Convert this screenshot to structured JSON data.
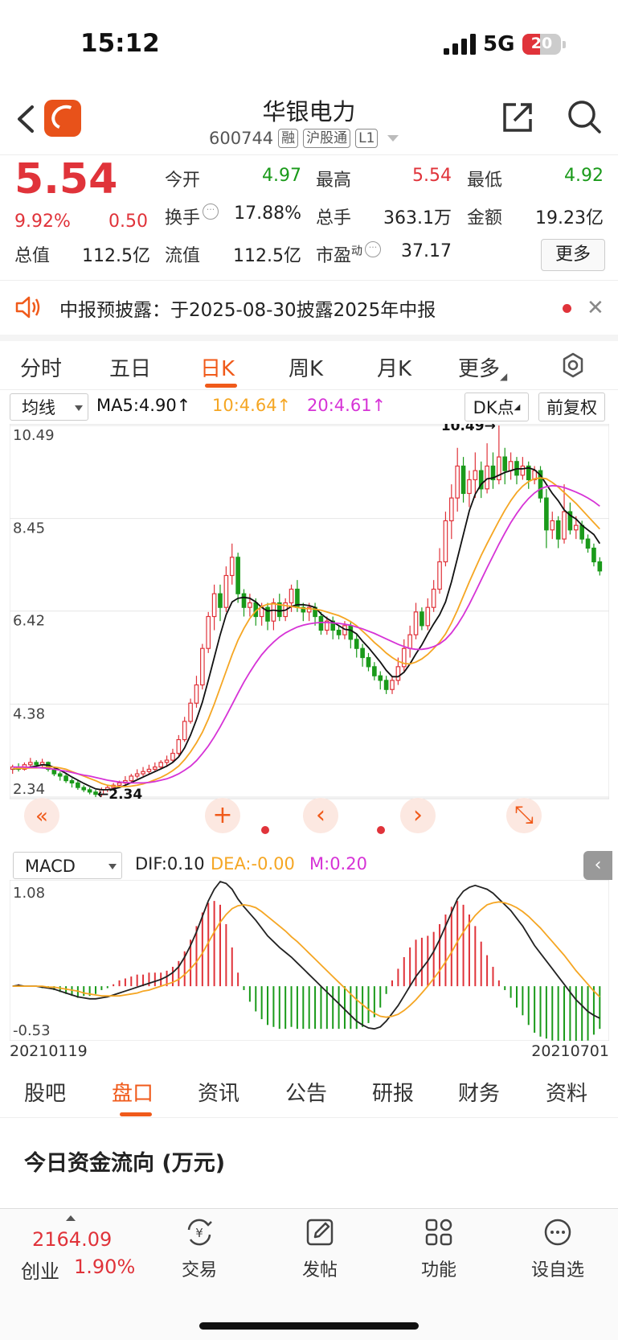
{
  "status_bar": {
    "time": "15:12",
    "network": "5G",
    "battery": "20"
  },
  "header": {
    "title": "华银电力",
    "code": "600744",
    "tags": [
      "融",
      "沪股通",
      "L1"
    ]
  },
  "quote": {
    "price": "5.54",
    "change_pct": "9.92%",
    "change": "0.50",
    "fields": [
      {
        "label": "今开",
        "value": "4.97",
        "color": "green"
      },
      {
        "label": "最高",
        "value": "5.54",
        "color": "red"
      },
      {
        "label": "最低",
        "value": "4.92",
        "color": "green"
      },
      {
        "label": "换手",
        "value": "17.88%",
        "color": "black"
      },
      {
        "label": "总手",
        "value": "363.1万",
        "color": "black"
      },
      {
        "label": "金额",
        "value": "19.23亿",
        "color": "black"
      },
      {
        "label": "总值",
        "value": "112.5亿",
        "color": "black"
      },
      {
        "label": "流值",
        "value": "112.5亿",
        "color": "black"
      },
      {
        "label": "市盈",
        "value": "37.17",
        "color": "black"
      }
    ],
    "pe_suffix": "动",
    "more_label": "更多"
  },
  "notice": {
    "text": "中报预披露：于2025-08-30披露2025年中报"
  },
  "kline_tabs": [
    "分时",
    "五日",
    "日K",
    "周K",
    "月K",
    "更多"
  ],
  "ma_bar": {
    "selector": "均线",
    "ma5": "MA5:4.90↑",
    "ma10": "10:4.64↑",
    "ma20": "20:4.61↑",
    "dk_label": "DK点",
    "adj_label": "前复权"
  },
  "macd_bar": {
    "selector": "MACD",
    "dif": "DIF:0.10",
    "dea": "DEA:-0.00",
    "m": "M:0.20"
  },
  "chart_data": [
    {
      "type": "candlestick",
      "title": "",
      "ylim": [
        2.34,
        10.49
      ],
      "yticks": [
        "10.49",
        "8.45",
        "6.42",
        "4.38",
        "2.34"
      ],
      "annotations": {
        "high": "10.49→",
        "low": "←2.34"
      },
      "x_start": "20210119",
      "x_end": "20210701",
      "candles": [
        [
          2.95,
          3.0,
          2.85,
          3.05
        ],
        [
          3.0,
          2.95,
          2.9,
          3.08
        ],
        [
          2.95,
          3.05,
          2.92,
          3.1
        ],
        [
          3.05,
          3.1,
          3.0,
          3.2
        ],
        [
          3.1,
          3.05,
          3.0,
          3.15
        ],
        [
          3.05,
          3.1,
          3.0,
          3.18
        ],
        [
          3.1,
          2.95,
          2.9,
          3.12
        ],
        [
          2.95,
          2.85,
          2.8,
          2.98
        ],
        [
          2.85,
          2.8,
          2.7,
          2.9
        ],
        [
          2.8,
          2.7,
          2.65,
          2.85
        ],
        [
          2.7,
          2.65,
          2.55,
          2.75
        ],
        [
          2.65,
          2.55,
          2.5,
          2.7
        ],
        [
          2.55,
          2.5,
          2.45,
          2.6
        ],
        [
          2.5,
          2.45,
          2.4,
          2.55
        ],
        [
          2.45,
          2.4,
          2.34,
          2.5
        ],
        [
          2.4,
          2.5,
          2.35,
          2.55
        ],
        [
          2.5,
          2.55,
          2.45,
          2.6
        ],
        [
          2.55,
          2.6,
          2.5,
          2.65
        ],
        [
          2.6,
          2.65,
          2.55,
          2.7
        ],
        [
          2.65,
          2.7,
          2.6,
          2.8
        ],
        [
          2.7,
          2.8,
          2.65,
          2.85
        ],
        [
          2.8,
          2.85,
          2.75,
          2.95
        ],
        [
          2.85,
          2.9,
          2.8,
          3.0
        ],
        [
          2.9,
          2.95,
          2.85,
          3.05
        ],
        [
          2.95,
          3.0,
          2.9,
          3.1
        ],
        [
          3.0,
          3.1,
          2.95,
          3.15
        ],
        [
          3.1,
          3.15,
          3.0,
          3.25
        ],
        [
          3.15,
          3.3,
          3.1,
          3.4
        ],
        [
          3.3,
          3.6,
          3.25,
          3.7
        ],
        [
          3.6,
          4.0,
          3.55,
          4.1
        ],
        [
          4.0,
          4.4,
          3.95,
          4.5
        ],
        [
          4.4,
          4.8,
          4.3,
          5.0
        ],
        [
          4.8,
          5.6,
          4.7,
          5.7
        ],
        [
          5.6,
          6.3,
          5.5,
          6.4
        ],
        [
          6.3,
          6.8,
          6.0,
          7.0
        ],
        [
          6.8,
          6.5,
          6.2,
          7.0
        ],
        [
          6.5,
          7.2,
          6.4,
          7.4
        ],
        [
          7.2,
          7.6,
          7.0,
          7.9
        ],
        [
          7.6,
          6.8,
          6.6,
          7.7
        ],
        [
          6.8,
          6.5,
          6.3,
          6.9
        ],
        [
          6.5,
          6.6,
          6.3,
          6.8
        ],
        [
          6.6,
          6.3,
          6.1,
          6.7
        ],
        [
          6.3,
          6.5,
          6.1,
          6.6
        ],
        [
          6.5,
          6.2,
          6.0,
          6.6
        ],
        [
          6.2,
          6.6,
          6.0,
          6.7
        ],
        [
          6.6,
          6.3,
          6.2,
          6.8
        ],
        [
          6.3,
          6.6,
          6.2,
          6.7
        ],
        [
          6.6,
          6.9,
          6.4,
          7.0
        ],
        [
          6.9,
          6.5,
          6.4,
          7.1
        ],
        [
          6.5,
          6.4,
          6.2,
          6.6
        ],
        [
          6.4,
          6.5,
          6.2,
          6.6
        ],
        [
          6.5,
          6.3,
          6.1,
          6.6
        ],
        [
          6.3,
          6.0,
          5.9,
          6.4
        ],
        [
          6.0,
          6.2,
          5.9,
          6.3
        ],
        [
          6.2,
          6.0,
          5.8,
          6.3
        ],
        [
          6.0,
          5.9,
          5.8,
          6.1
        ],
        [
          5.9,
          6.1,
          5.8,
          6.2
        ],
        [
          6.1,
          5.8,
          5.6,
          6.2
        ],
        [
          5.8,
          5.6,
          5.4,
          5.9
        ],
        [
          5.6,
          5.4,
          5.2,
          5.7
        ],
        [
          5.4,
          5.2,
          5.1,
          5.5
        ],
        [
          5.2,
          5.0,
          4.9,
          5.3
        ],
        [
          5.0,
          4.9,
          4.7,
          5.1
        ],
        [
          4.9,
          4.7,
          4.6,
          5.0
        ],
        [
          4.7,
          4.9,
          4.6,
          5.0
        ],
        [
          4.9,
          5.2,
          4.8,
          5.4
        ],
        [
          5.2,
          5.6,
          5.1,
          5.8
        ],
        [
          5.6,
          5.9,
          5.4,
          6.1
        ],
        [
          5.9,
          6.4,
          5.8,
          6.6
        ],
        [
          6.4,
          6.1,
          6.0,
          6.5
        ],
        [
          6.1,
          6.5,
          6.0,
          6.7
        ],
        [
          6.5,
          6.9,
          6.4,
          7.1
        ],
        [
          6.9,
          7.5,
          6.8,
          7.8
        ],
        [
          7.5,
          8.4,
          7.4,
          8.6
        ],
        [
          8.4,
          8.9,
          8.0,
          9.2
        ],
        [
          8.9,
          9.6,
          8.6,
          10.0
        ],
        [
          9.6,
          9.0,
          8.8,
          9.8
        ],
        [
          9.0,
          9.3,
          8.7,
          9.5
        ],
        [
          9.3,
          9.5,
          8.9,
          9.9
        ],
        [
          9.5,
          9.1,
          8.9,
          9.7
        ],
        [
          9.1,
          9.6,
          9.0,
          10.1
        ],
        [
          9.6,
          9.3,
          9.1,
          9.9
        ],
        [
          9.3,
          9.8,
          9.2,
          10.49
        ],
        [
          9.8,
          9.5,
          9.2,
          10.0
        ],
        [
          9.5,
          9.7,
          9.3,
          9.9
        ],
        [
          9.7,
          9.4,
          9.2,
          9.8
        ],
        [
          9.4,
          9.6,
          9.3,
          9.8
        ],
        [
          9.6,
          9.3,
          9.1,
          9.7
        ],
        [
          9.3,
          9.5,
          9.2,
          9.6
        ],
        [
          9.5,
          8.9,
          8.8,
          9.6
        ],
        [
          8.9,
          8.2,
          7.8,
          9.1
        ],
        [
          8.2,
          8.4,
          8.0,
          8.6
        ],
        [
          8.4,
          8.0,
          7.8,
          8.5
        ],
        [
          8.0,
          8.6,
          7.9,
          9.2
        ],
        [
          8.6,
          8.2,
          8.1,
          8.8
        ],
        [
          8.2,
          8.3,
          8.0,
          8.5
        ],
        [
          8.3,
          8.0,
          7.9,
          8.4
        ],
        [
          8.0,
          7.8,
          7.7,
          8.1
        ],
        [
          7.8,
          7.5,
          7.4,
          7.9
        ],
        [
          7.5,
          7.3,
          7.2,
          7.6
        ]
      ],
      "ma5": [
        2.95,
        2.97,
        2.98,
        3.0,
        3.02,
        3.05,
        3.04,
        2.99,
        2.93,
        2.86,
        2.78,
        2.71,
        2.64,
        2.58,
        2.52,
        2.5,
        2.5,
        2.52,
        2.55,
        2.6,
        2.66,
        2.72,
        2.78,
        2.84,
        2.9,
        2.96,
        3.02,
        3.1,
        3.22,
        3.42,
        3.7,
        4.04,
        4.42,
        4.9,
        5.4,
        5.9,
        6.34,
        6.62,
        6.7,
        6.72,
        6.7,
        6.62,
        6.5,
        6.42,
        6.44,
        6.42,
        6.44,
        6.52,
        6.56,
        6.56,
        6.54,
        6.5,
        6.36,
        6.26,
        6.18,
        6.1,
        6.02,
        6.0,
        5.92,
        5.76,
        5.62,
        5.46,
        5.3,
        5.12,
        4.98,
        4.98,
        5.08,
        5.26,
        5.48,
        5.68,
        5.92,
        6.14,
        6.34,
        6.62,
        7.06,
        7.58,
        8.1,
        8.62,
        8.98,
        9.2,
        9.32,
        9.34,
        9.4,
        9.46,
        9.5,
        9.54,
        9.54,
        9.56,
        9.52,
        9.4,
        9.2,
        9.0,
        8.84,
        8.64,
        8.52,
        8.44,
        8.3,
        8.2,
        8.1,
        7.9
      ],
      "ma10": [
        2.96,
        2.97,
        2.97,
        2.98,
        2.98,
        2.99,
        3.0,
        3.0,
        2.98,
        2.95,
        2.9,
        2.85,
        2.8,
        2.75,
        2.7,
        2.64,
        2.6,
        2.58,
        2.57,
        2.57,
        2.58,
        2.6,
        2.63,
        2.67,
        2.72,
        2.77,
        2.84,
        2.92,
        3.02,
        3.16,
        3.33,
        3.53,
        3.76,
        4.05,
        4.38,
        4.74,
        5.1,
        5.46,
        5.78,
        6.04,
        6.26,
        6.42,
        6.52,
        6.57,
        6.58,
        6.56,
        6.54,
        6.52,
        6.5,
        6.48,
        6.47,
        6.46,
        6.44,
        6.4,
        6.36,
        6.32,
        6.26,
        6.19,
        6.1,
        5.98,
        5.86,
        5.73,
        5.62,
        5.5,
        5.4,
        5.32,
        5.27,
        5.26,
        5.3,
        5.37,
        5.47,
        5.6,
        5.74,
        5.92,
        6.16,
        6.44,
        6.75,
        7.06,
        7.35,
        7.64,
        7.9,
        8.15,
        8.4,
        8.63,
        8.84,
        9.02,
        9.16,
        9.26,
        9.32,
        9.34,
        9.32,
        9.24,
        9.14,
        9.02,
        8.9,
        8.78,
        8.64,
        8.5,
        8.36,
        8.22
      ],
      "ma20": [
        3.0,
        3.0,
        3.0,
        2.99,
        2.99,
        2.98,
        2.97,
        2.95,
        2.93,
        2.91,
        2.88,
        2.85,
        2.82,
        2.8,
        2.77,
        2.74,
        2.71,
        2.69,
        2.67,
        2.66,
        2.65,
        2.65,
        2.65,
        2.66,
        2.68,
        2.71,
        2.74,
        2.79,
        2.85,
        2.93,
        3.02,
        3.14,
        3.29,
        3.46,
        3.66,
        3.88,
        4.12,
        4.37,
        4.62,
        4.86,
        5.08,
        5.28,
        5.46,
        5.61,
        5.74,
        5.85,
        5.94,
        6.01,
        6.07,
        6.11,
        6.14,
        6.16,
        6.17,
        6.17,
        6.16,
        6.15,
        6.13,
        6.11,
        6.07,
        6.03,
        5.98,
        5.93,
        5.87,
        5.81,
        5.75,
        5.69,
        5.64,
        5.6,
        5.58,
        5.58,
        5.6,
        5.64,
        5.7,
        5.8,
        5.94,
        6.12,
        6.33,
        6.57,
        6.83,
        7.1,
        7.37,
        7.63,
        7.89,
        8.13,
        8.36,
        8.56,
        8.74,
        8.89,
        9.01,
        9.1,
        9.15,
        9.17,
        9.16,
        9.13,
        9.08,
        9.03,
        8.97,
        8.9,
        8.82,
        8.72
      ]
    },
    {
      "type": "macd",
      "ylim": [
        -0.53,
        1.08
      ],
      "yticks": [
        "1.08",
        "-0.53"
      ],
      "dif": [
        0.0,
        0.01,
        0.0,
        0.0,
        0.0,
        -0.01,
        -0.02,
        -0.03,
        -0.05,
        -0.07,
        -0.09,
        -0.11,
        -0.12,
        -0.13,
        -0.13,
        -0.12,
        -0.11,
        -0.09,
        -0.07,
        -0.05,
        -0.03,
        -0.01,
        0.01,
        0.03,
        0.05,
        0.07,
        0.1,
        0.14,
        0.2,
        0.3,
        0.42,
        0.56,
        0.72,
        0.88,
        1.0,
        1.08,
        1.06,
        1.0,
        0.9,
        0.82,
        0.75,
        0.68,
        0.6,
        0.52,
        0.46,
        0.4,
        0.35,
        0.3,
        0.24,
        0.18,
        0.12,
        0.06,
        0.0,
        -0.06,
        -0.12,
        -0.18,
        -0.24,
        -0.3,
        -0.36,
        -0.4,
        -0.43,
        -0.44,
        -0.42,
        -0.36,
        -0.28,
        -0.2,
        -0.1,
        0.0,
        0.1,
        0.18,
        0.26,
        0.36,
        0.48,
        0.62,
        0.76,
        0.9,
        0.98,
        1.02,
        1.04,
        1.02,
        1.0,
        0.96,
        0.9,
        0.84,
        0.78,
        0.7,
        0.62,
        0.52,
        0.42,
        0.34,
        0.26,
        0.18,
        0.1,
        0.02,
        -0.06,
        -0.14,
        -0.2,
        -0.26,
        -0.3,
        -0.33
      ],
      "dea": [
        0.0,
        0.0,
        0.0,
        0.0,
        0.0,
        0.0,
        -0.01,
        -0.01,
        -0.02,
        -0.03,
        -0.04,
        -0.05,
        -0.07,
        -0.08,
        -0.09,
        -0.1,
        -0.1,
        -0.1,
        -0.1,
        -0.09,
        -0.08,
        -0.07,
        -0.05,
        -0.04,
        -0.02,
        0.0,
        0.02,
        0.04,
        0.07,
        0.12,
        0.18,
        0.25,
        0.34,
        0.45,
        0.56,
        0.66,
        0.74,
        0.8,
        0.83,
        0.84,
        0.83,
        0.81,
        0.77,
        0.72,
        0.67,
        0.62,
        0.57,
        0.51,
        0.46,
        0.4,
        0.34,
        0.28,
        0.22,
        0.16,
        0.1,
        0.04,
        -0.02,
        -0.08,
        -0.14,
        -0.19,
        -0.24,
        -0.28,
        -0.31,
        -0.32,
        -0.31,
        -0.29,
        -0.25,
        -0.2,
        -0.14,
        -0.07,
        0.0,
        0.08,
        0.16,
        0.25,
        0.35,
        0.46,
        0.56,
        0.65,
        0.73,
        0.79,
        0.84,
        0.86,
        0.87,
        0.86,
        0.84,
        0.81,
        0.77,
        0.72,
        0.66,
        0.6,
        0.53,
        0.46,
        0.39,
        0.32,
        0.24,
        0.16,
        0.09,
        0.02,
        -0.05,
        -0.11
      ],
      "hist": [
        0.0,
        0.02,
        0.0,
        0.0,
        0.0,
        -0.02,
        -0.02,
        -0.04,
        -0.06,
        -0.08,
        -0.1,
        -0.12,
        -0.1,
        -0.1,
        -0.08,
        -0.04,
        -0.02,
        0.02,
        0.06,
        0.08,
        0.1,
        0.12,
        0.12,
        0.14,
        0.14,
        0.14,
        0.16,
        0.2,
        0.26,
        0.36,
        0.48,
        0.62,
        0.76,
        0.86,
        0.88,
        0.84,
        0.64,
        0.4,
        0.14,
        -0.04,
        -0.16,
        -0.26,
        -0.34,
        -0.4,
        -0.42,
        -0.44,
        -0.44,
        -0.42,
        -0.44,
        -0.44,
        -0.44,
        -0.44,
        -0.44,
        -0.44,
        -0.44,
        -0.44,
        -0.44,
        -0.44,
        -0.44,
        -0.42,
        -0.38,
        -0.32,
        -0.22,
        -0.08,
        0.06,
        0.18,
        0.3,
        0.4,
        0.48,
        0.5,
        0.52,
        0.56,
        0.64,
        0.74,
        0.82,
        0.88,
        0.84,
        0.74,
        0.62,
        0.46,
        0.32,
        0.2,
        0.06,
        -0.04,
        -0.12,
        -0.22,
        -0.3,
        -0.4,
        -0.48,
        -0.52,
        -0.54,
        -0.56,
        -0.58,
        -0.6,
        -0.6,
        -0.6,
        -0.58,
        -0.56,
        -0.5,
        -0.44
      ]
    }
  ],
  "chart_controls": [
    "plus-icon",
    "arrow-left-icon",
    "arrow-right-icon",
    "expand-icon"
  ],
  "info_tabs": [
    "股吧",
    "盘口",
    "资讯",
    "公告",
    "研报",
    "财务",
    "资料"
  ],
  "section": {
    "title": "今日资金流向 (万元)"
  },
  "bottom_bar": {
    "index_value": "2164.09",
    "index_name": "创业",
    "index_pct": "1.90%",
    "items": [
      "交易",
      "发帖",
      "功能",
      "设自选"
    ]
  },
  "colors": {
    "up": "#e0333a",
    "down": "#1a9a1a",
    "accent": "#f05a1a",
    "ma5": "#111111",
    "ma10": "#f5a623",
    "ma20": "#d633d6"
  }
}
